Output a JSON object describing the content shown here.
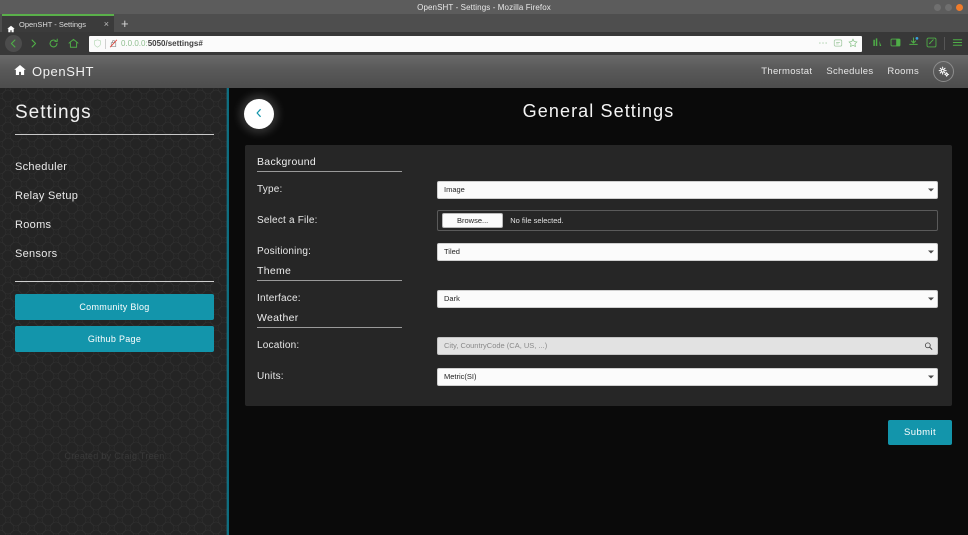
{
  "browser": {
    "window_title": "OpenSHT - Settings - Mozilla Firefox",
    "tab_label": "OpenSHT - Settings",
    "tab_close": "×",
    "new_tab": "+",
    "url_host": "0.0.0.0:",
    "url_path": "5050/settings#"
  },
  "navbar": {
    "brand": "OpenSHT",
    "links": [
      {
        "label": "Thermostat"
      },
      {
        "label": "Schedules"
      },
      {
        "label": "Rooms"
      }
    ],
    "settings_icon": "cogs-icon"
  },
  "sidebar": {
    "title": "Settings",
    "items": [
      {
        "label": "Scheduler"
      },
      {
        "label": "Relay Setup"
      },
      {
        "label": "Rooms"
      },
      {
        "label": "Sensors"
      }
    ],
    "buttons": [
      {
        "label": "Community Blog"
      },
      {
        "label": "Github Page"
      }
    ],
    "footer": "Created by Craig Treen"
  },
  "main": {
    "title": "General Settings",
    "back_icon": "chevron-left-icon",
    "sections": [
      {
        "heading": "Background",
        "fields": [
          {
            "label": "Type:",
            "kind": "select",
            "value": "Image"
          },
          {
            "label": "Select a File:",
            "kind": "file",
            "browse_label": "Browse...",
            "status": "No file selected."
          },
          {
            "label": "Positioning:",
            "kind": "select",
            "value": "Tiled"
          }
        ]
      },
      {
        "heading": "Theme",
        "fields": [
          {
            "label": "Interface:",
            "kind": "select",
            "value": "Dark"
          }
        ]
      },
      {
        "heading": "Weather",
        "fields": [
          {
            "label": "Location:",
            "kind": "search",
            "value": "",
            "placeholder": "City, CountryCode (CA, US, ...)"
          },
          {
            "label": "Units:",
            "kind": "select",
            "value": "Metric(SI)"
          }
        ]
      }
    ],
    "submit_label": "Submit"
  },
  "colors": {
    "accent": "#1395ab",
    "panel": "#262626",
    "page_bg": "#0b0b0b",
    "sidebar_bg": "#242424"
  }
}
